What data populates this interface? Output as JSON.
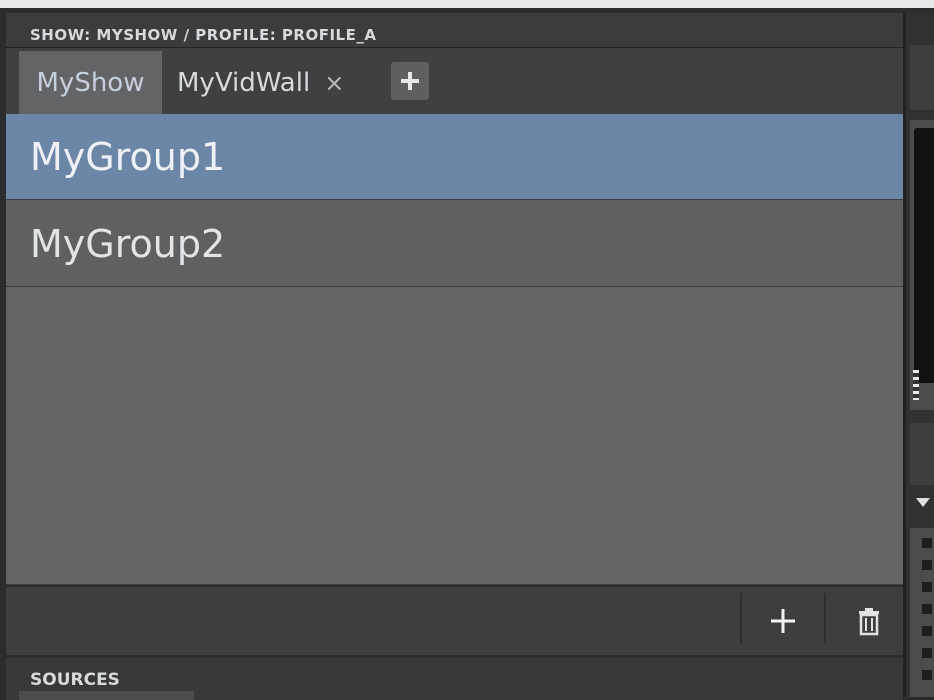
{
  "panel": {
    "title": "SHOW: MYSHOW / PROFILE: PROFILE_A"
  },
  "tabs": [
    {
      "label": "MyShow",
      "active": true
    },
    {
      "label": "MyVidWall",
      "closable": true,
      "close_glyph": "×"
    }
  ],
  "groups": [
    {
      "label": "MyGroup1",
      "selected": true
    },
    {
      "label": "MyGroup2",
      "selected": false
    }
  ],
  "toolbar": {
    "add_icon": "plus-icon",
    "delete_icon": "trash-icon"
  },
  "sources": {
    "title": "SOURCES"
  },
  "colors": {
    "selected_row": "#6b86a6",
    "list_background": "#626466",
    "panel_background": "#3b3d3f"
  }
}
